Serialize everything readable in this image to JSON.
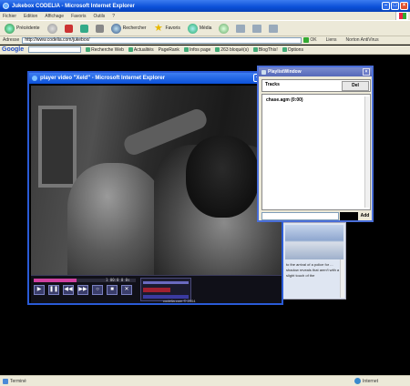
{
  "browser": {
    "window_title": "Jukebox CODELIA - Microsoft Internet Explorer",
    "menu": [
      "Fichier",
      "Edition",
      "Affichage",
      "Favoris",
      "Outils",
      "?"
    ],
    "toolbar": {
      "back_label": "Précédente",
      "search_label": "Rechercher",
      "favorites_label": "Favoris",
      "media_label": "Média"
    },
    "address": {
      "label": "Adresse",
      "value": "http://www.codelia.com/jukebox/",
      "go_label": "OK",
      "links_label": "Liens",
      "norton_label": "Norton AntiVirus"
    },
    "google_bar": {
      "logo": "Google",
      "search_web_label": "Recherche Web",
      "news_label": "Actualités",
      "pagerank_label": "PageRank",
      "info_label": "Infos page",
      "blocked_label": "263 bloqué(s)",
      "blogthis_label": "BlogThis!",
      "options_label": "Options"
    },
    "status": {
      "left_text": "Terminé",
      "zone_text": "Internet"
    }
  },
  "player_window": {
    "title": "player video \"Xeld\" - Microsoft Internet Explorer",
    "timecode": "1 00:0 0 0s",
    "seek_progress": 0.42,
    "logo_text": "codelia.com © 2004"
  },
  "playlist_window": {
    "title": "PlaylistWindow",
    "tracks_header": "Tracks",
    "delete_label": "Del",
    "items": [
      "chase.agm (0:00)"
    ],
    "add_label": "Add"
  },
  "side_panel": {
    "text": "to the arrival of a police for ... shadow reveals that aren't with a slight touch of the"
  },
  "colors": {
    "xp_blue": "#0a4fd8",
    "chrome": "#ece9d8",
    "playlist_title": "#5668b8",
    "seek_fill": "#d040a0"
  }
}
